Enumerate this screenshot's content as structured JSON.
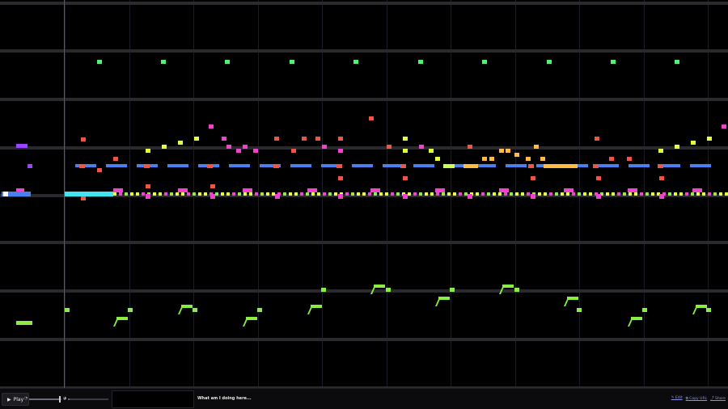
{
  "song": {
    "title": "What am I doing here..."
  },
  "controls": {
    "play_label": "Play",
    "play_icon": "play-icon"
  },
  "links": {
    "edit": "✎ Edit",
    "copy_url": "⧉ Copy URL",
    "share": "⤴ Share"
  },
  "colors": {
    "background": "#000000",
    "row_line": "#2a2a2e",
    "beat_line": "#1b1b26",
    "playhead": "#e0185a",
    "green_notes": "#55ee77",
    "blue_notes": "#4a80ee",
    "pink_notes": "#ee44cc",
    "salmon_notes": "#ee5544",
    "yellow_notes": "#e6ff44",
    "lime_notes": "#88ee44",
    "cyan_notes": "#44e4ee",
    "orange_notes": "#ffbb44",
    "purple_notes": "#9944ff",
    "lightgreen_notes": "#ccff55"
  }
}
